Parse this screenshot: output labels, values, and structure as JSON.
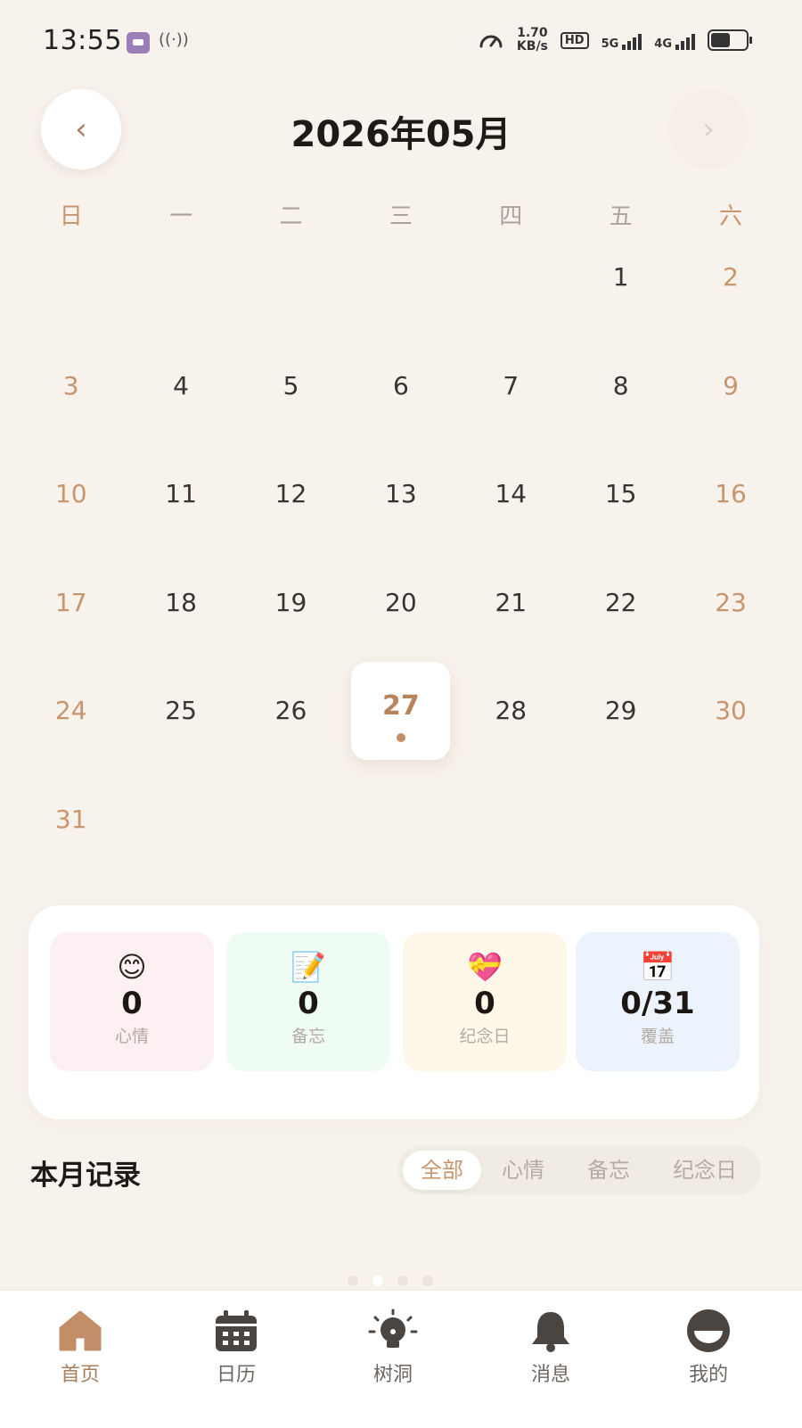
{
  "status_bar": {
    "time": "13:55",
    "net_speed_value": "1.70",
    "net_speed_unit": "KB/s",
    "hd_label": "HD",
    "signal1_label": "5G",
    "signal2_label": "4G",
    "battery_level": 0.55
  },
  "header": {
    "title": "2026年05月",
    "prev_label": "‹",
    "next_label": "›"
  },
  "weekdays": [
    "日",
    "一",
    "二",
    "三",
    "四",
    "五",
    "六"
  ],
  "calendar": {
    "weeks": [
      [
        "",
        "",
        "",
        "",
        "",
        "1",
        "2"
      ],
      [
        "3",
        "4",
        "5",
        "6",
        "7",
        "8",
        "9"
      ],
      [
        "10",
        "11",
        "12",
        "13",
        "14",
        "15",
        "16"
      ],
      [
        "17",
        "18",
        "19",
        "20",
        "21",
        "22",
        "23"
      ],
      [
        "24",
        "25",
        "26",
        "27",
        "28",
        "29",
        "30"
      ],
      [
        "31",
        "",
        "",
        "",
        "",
        "",
        ""
      ]
    ],
    "today": "27"
  },
  "stats": [
    {
      "emoji": "😊",
      "value": "0",
      "label": "心情"
    },
    {
      "emoji": "📝",
      "value": "0",
      "label": "备忘"
    },
    {
      "emoji": "💝",
      "value": "0",
      "label": "纪念日"
    },
    {
      "emoji": "📅",
      "value": "0/31",
      "label": "覆盖"
    }
  ],
  "records": {
    "title": "本月记录",
    "filters": [
      "全部",
      "心情",
      "备忘",
      "纪念日"
    ],
    "active_filter": "全部"
  },
  "bottom_nav": [
    {
      "label": "首页",
      "icon": "home-icon",
      "active": true
    },
    {
      "label": "日历",
      "icon": "calendar-icon",
      "active": false
    },
    {
      "label": "树洞",
      "icon": "lightbulb-icon",
      "active": false
    },
    {
      "label": "消息",
      "icon": "bell-icon",
      "active": false
    },
    {
      "label": "我的",
      "icon": "profile-icon",
      "active": false
    }
  ],
  "colors": {
    "background": "#f7f2ec",
    "accent": "#c9956d",
    "nav_active": "#a8805e"
  }
}
